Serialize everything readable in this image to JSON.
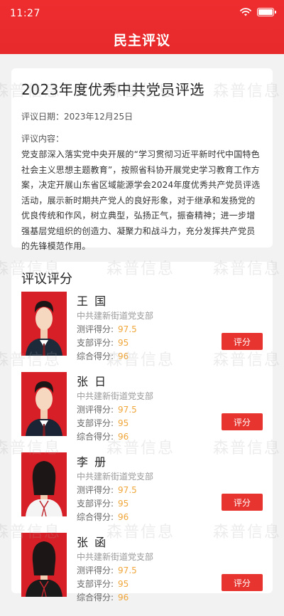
{
  "status": {
    "time": "11:27"
  },
  "header": {
    "title": "民主评议"
  },
  "notice": {
    "title": "2023年度优秀中共党员评选",
    "date_text": "评议日期：2023年12月25日",
    "content_label": "评议内容：",
    "content": "党支部深入落实党中央开展的“学习贯彻习近平新时代中国特色社会主义思想主题教育”，按照省科协开展党史学习教育工作方案，决定开展山东省区域能源学会2024年度优秀共产党员评选活动，展示新时期共产党人的良好形象，对于继承和发扬党的优良传统和作风，树立典型，弘扬正气，振奋精神；进一步增强基层党组织的创造力、凝聚力和战斗力，充分发挥共产党员的先锋模范作用。"
  },
  "review": {
    "section_title": "评议评分",
    "labels": {
      "eval": "测评得分:",
      "branch": "支部评分:",
      "total": "综合得分:",
      "button": "评分"
    },
    "people": [
      {
        "name": "王 国",
        "org": "中共建新街道党支部",
        "eval": "97.5",
        "branch": "95",
        "total": "96",
        "gender": "male",
        "shirt": "#1d2a3a"
      },
      {
        "name": "张 日",
        "org": "中共建新街道党支部",
        "eval": "97.5",
        "branch": "95",
        "total": "96",
        "gender": "male",
        "shirt": "#1b2435"
      },
      {
        "name": "李 册",
        "org": "中共建新街道党支部",
        "eval": "97.5",
        "branch": "95",
        "total": "96",
        "gender": "female",
        "shirt": "#f4f4f4"
      },
      {
        "name": "张 函",
        "org": "中共建新街道党支部",
        "eval": "97.5",
        "branch": "95",
        "total": "96",
        "gender": "female",
        "shirt": "#1a1a1a"
      }
    ]
  },
  "watermark": "森普信息",
  "colors": {
    "brand_red": "#e72a2c",
    "score_orange": "#f0a63a",
    "button_red": "#e8342f"
  }
}
